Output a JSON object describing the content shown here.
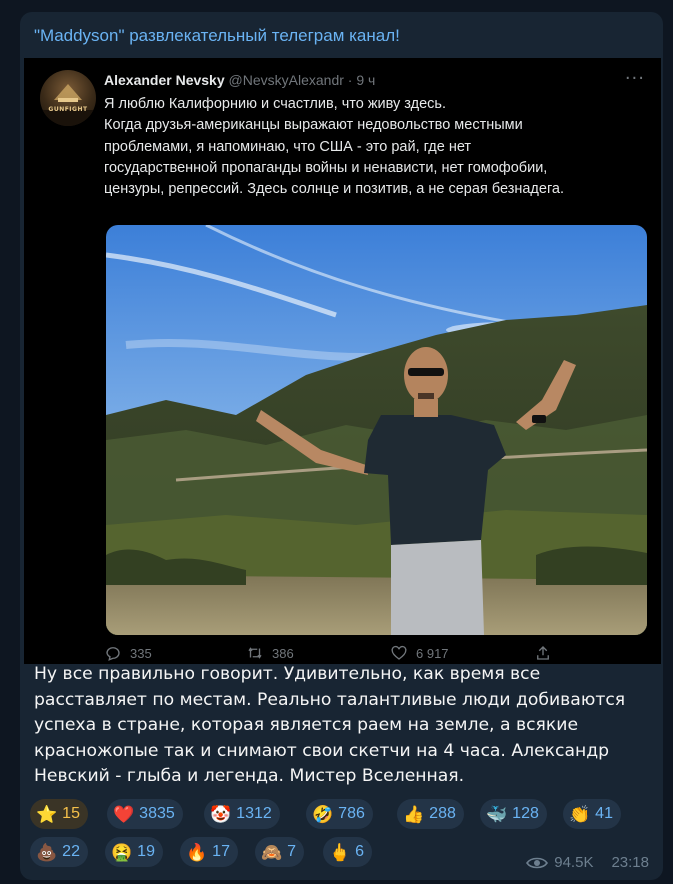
{
  "channel": {
    "title": "\"Maddyson\" развлекательный телеграм канал!"
  },
  "tweet": {
    "author_name": "Alexander Nevsky",
    "author_handle": "@NevskyAlexandr",
    "time": "· 9 ч",
    "avatar_label": "GUNFIGHT",
    "text_lines": [
      "Я люблю Калифорнию и счастлив, что живу здесь.",
      "Когда друзья-американцы выражают недовольство местными",
      "проблемами, я напоминаю, что США - это рай, где нет",
      "государственной пропаганды войны и ненависти, нет гомофобии,",
      "цензуры, репрессий. Здесь солнце и позитив, а не серая безнадега."
    ],
    "replies": "335",
    "retweets": "386",
    "likes": "6 917"
  },
  "post": {
    "text_lines": [
      "Ну все правильно говорит. Удивительно, как время все",
      "расставляет по местам. Реально талантливые люди добиваются",
      "успеха в стране, которая является раем на земле, а всякие",
      "красножопые так и снимают свои скетчи на 4 часа. Александр",
      "Невский - глыба и легенда. Мистер Вселенная."
    ]
  },
  "reactions": [
    {
      "emoji": "⭐",
      "count": "15",
      "icon": "star-icon",
      "active": true
    },
    {
      "emoji": "❤️",
      "count": "3835",
      "icon": "heart-icon"
    },
    {
      "emoji": "🤡",
      "count": "1312",
      "icon": "clown-icon"
    },
    {
      "emoji": "🤣",
      "count": "786",
      "icon": "rofl-icon"
    },
    {
      "emoji": "👍",
      "count": "288",
      "icon": "thumbs-up-icon"
    },
    {
      "emoji": "🐳",
      "count": "128",
      "icon": "whale-icon"
    },
    {
      "emoji": "👏",
      "count": "41",
      "icon": "clapping-icon"
    },
    {
      "emoji": "💩",
      "count": "22",
      "icon": "poop-icon"
    },
    {
      "emoji": "🤮",
      "count": "19",
      "icon": "vomit-icon"
    },
    {
      "emoji": "🔥",
      "count": "17",
      "icon": "fire-icon"
    },
    {
      "emoji": "🙈",
      "count": "7",
      "icon": "see-no-evil-icon"
    },
    {
      "emoji": "🖕",
      "count": "6",
      "icon": "middle-finger-icon"
    }
  ],
  "meta": {
    "views": "94.5K",
    "time": "23:18"
  },
  "colors": {
    "bg": "#0e1621",
    "bubble": "#182533",
    "accent": "#6ab3f3",
    "reaction_bg": "#233447"
  }
}
